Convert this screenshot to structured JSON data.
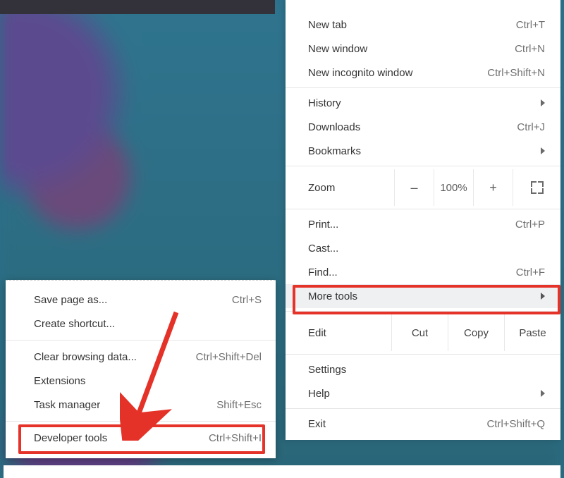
{
  "menu": {
    "section1": [
      {
        "label": "New tab",
        "shortcut": "Ctrl+T"
      },
      {
        "label": "New window",
        "shortcut": "Ctrl+N"
      },
      {
        "label": "New incognito window",
        "shortcut": "Ctrl+Shift+N"
      }
    ],
    "section2": [
      {
        "label": "History",
        "kind": "submenu"
      },
      {
        "label": "Downloads",
        "shortcut": "Ctrl+J"
      },
      {
        "label": "Bookmarks",
        "kind": "submenu"
      }
    ],
    "zoom": {
      "label": "Zoom",
      "percent": "100%",
      "minus": "–",
      "plus": "+"
    },
    "section3": [
      {
        "label": "Print...",
        "shortcut": "Ctrl+P"
      },
      {
        "label": "Cast..."
      },
      {
        "label": "Find...",
        "shortcut": "Ctrl+F"
      },
      {
        "label": "More tools",
        "kind": "submenu",
        "hover": true
      }
    ],
    "edit": {
      "label": "Edit",
      "cut": "Cut",
      "copy": "Copy",
      "paste": "Paste"
    },
    "section4": [
      {
        "label": "Settings"
      },
      {
        "label": "Help",
        "kind": "submenu"
      }
    ],
    "section5": [
      {
        "label": "Exit",
        "shortcut": "Ctrl+Shift+Q"
      }
    ]
  },
  "submenu": {
    "section1": [
      {
        "label": "Save page as...",
        "shortcut": "Ctrl+S"
      },
      {
        "label": "Create shortcut..."
      }
    ],
    "section2": [
      {
        "label": "Clear browsing data...",
        "shortcut": "Ctrl+Shift+Del"
      },
      {
        "label": "Extensions"
      },
      {
        "label": "Task manager",
        "shortcut": "Shift+Esc"
      }
    ],
    "section3": [
      {
        "label": "Developer tools",
        "shortcut": "Ctrl+Shift+I"
      }
    ]
  },
  "highlights": {
    "more_tools_color": "#e63329",
    "developer_tools_color": "#e63329",
    "arrow_color": "#e43228"
  }
}
